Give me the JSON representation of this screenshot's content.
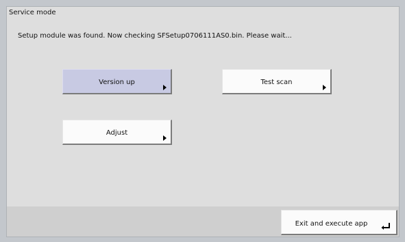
{
  "window": {
    "title": "Service mode",
    "status_text": "Setup module was found. Now checking SFSetup0706111AS0.bin. Please wait..."
  },
  "buttons": {
    "version_up": "Version up",
    "test_scan": "Test scan",
    "adjust": "Adjust"
  },
  "footer": {
    "exit_label": "Exit and execute app"
  },
  "icons": {
    "arrow": "right-triangle-icon",
    "enter": "enter-return-icon"
  },
  "colors": {
    "active_button": "#c8cae3",
    "window_bg": "#dedede",
    "footer_bg": "#cfcfcf"
  }
}
